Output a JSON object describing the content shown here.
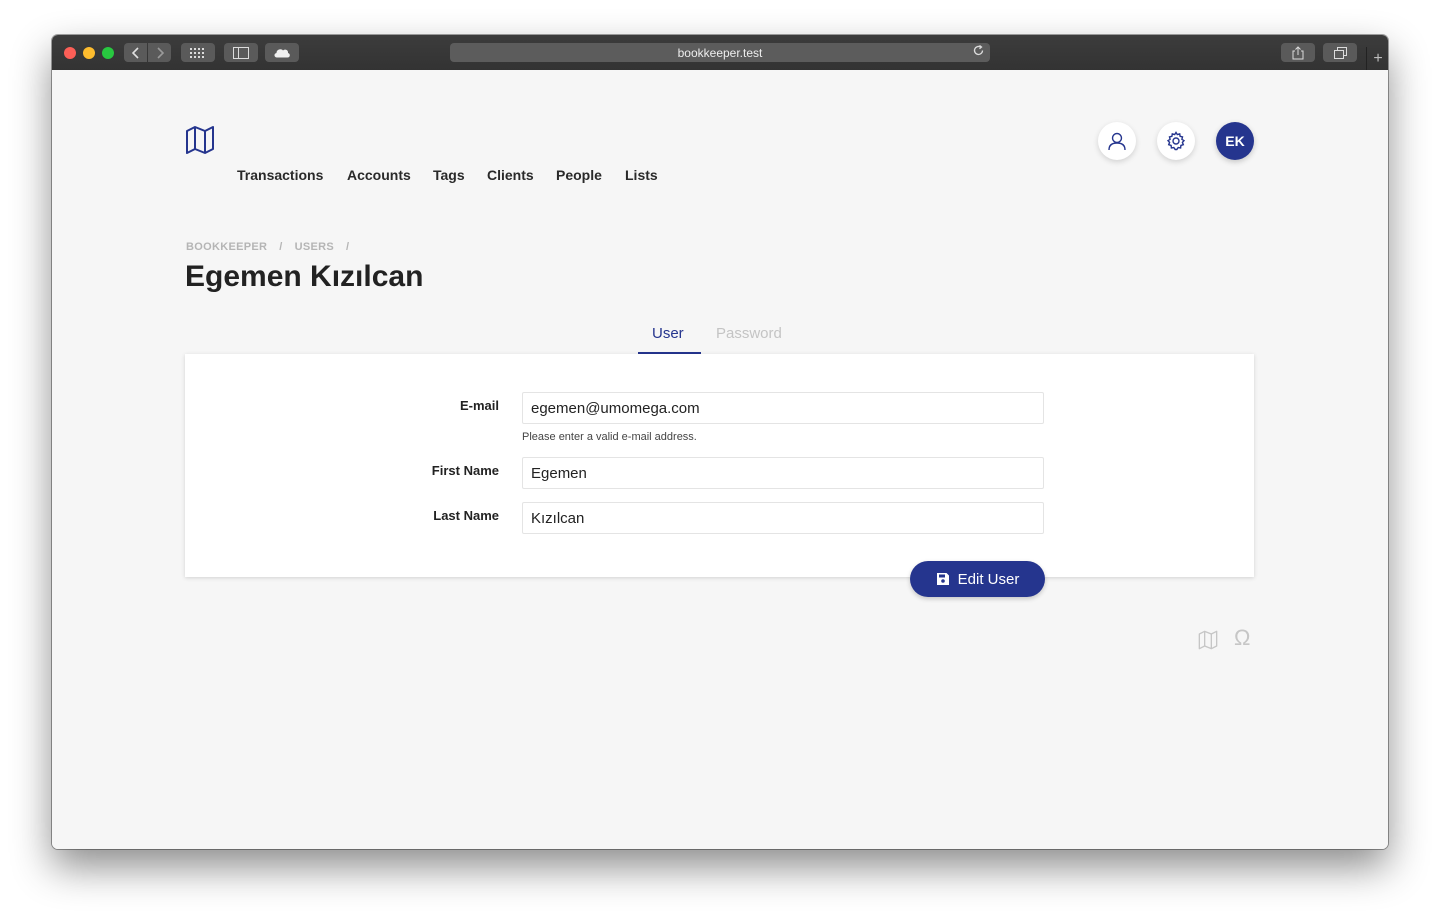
{
  "browser": {
    "url": "bookkeeper.test"
  },
  "nav": {
    "logo_icon": "map-icon",
    "items": [
      "Transactions",
      "Accounts",
      "Tags",
      "Clients",
      "People",
      "Lists"
    ],
    "avatar_initials": "EK",
    "profile_icon": "user-icon",
    "settings_icon": "gear-icon"
  },
  "breadcrumb": {
    "items": [
      "BOOKKEEPER",
      "/",
      "USERS",
      "/"
    ]
  },
  "page": {
    "title": "Egemen Kızılcan"
  },
  "tabs": [
    {
      "label": "User",
      "active": true
    },
    {
      "label": "Password",
      "active": false
    }
  ],
  "form": {
    "email_label": "E-mail",
    "email_value": "egemen@umomega.com",
    "email_hint": "Please enter a valid e-mail address.",
    "first_name_label": "First Name",
    "first_name_value": "Egemen",
    "last_name_label": "Last Name",
    "last_name_value": "Kızılcan",
    "submit_label": "Edit User",
    "submit_icon": "save-icon"
  },
  "footer": {
    "icons": [
      "map-icon",
      "omega-icon"
    ],
    "omega_symbol": "Ω"
  },
  "colors": {
    "accent": "#25358e",
    "background": "#f6f6f6",
    "muted": "#b5b5b5"
  }
}
